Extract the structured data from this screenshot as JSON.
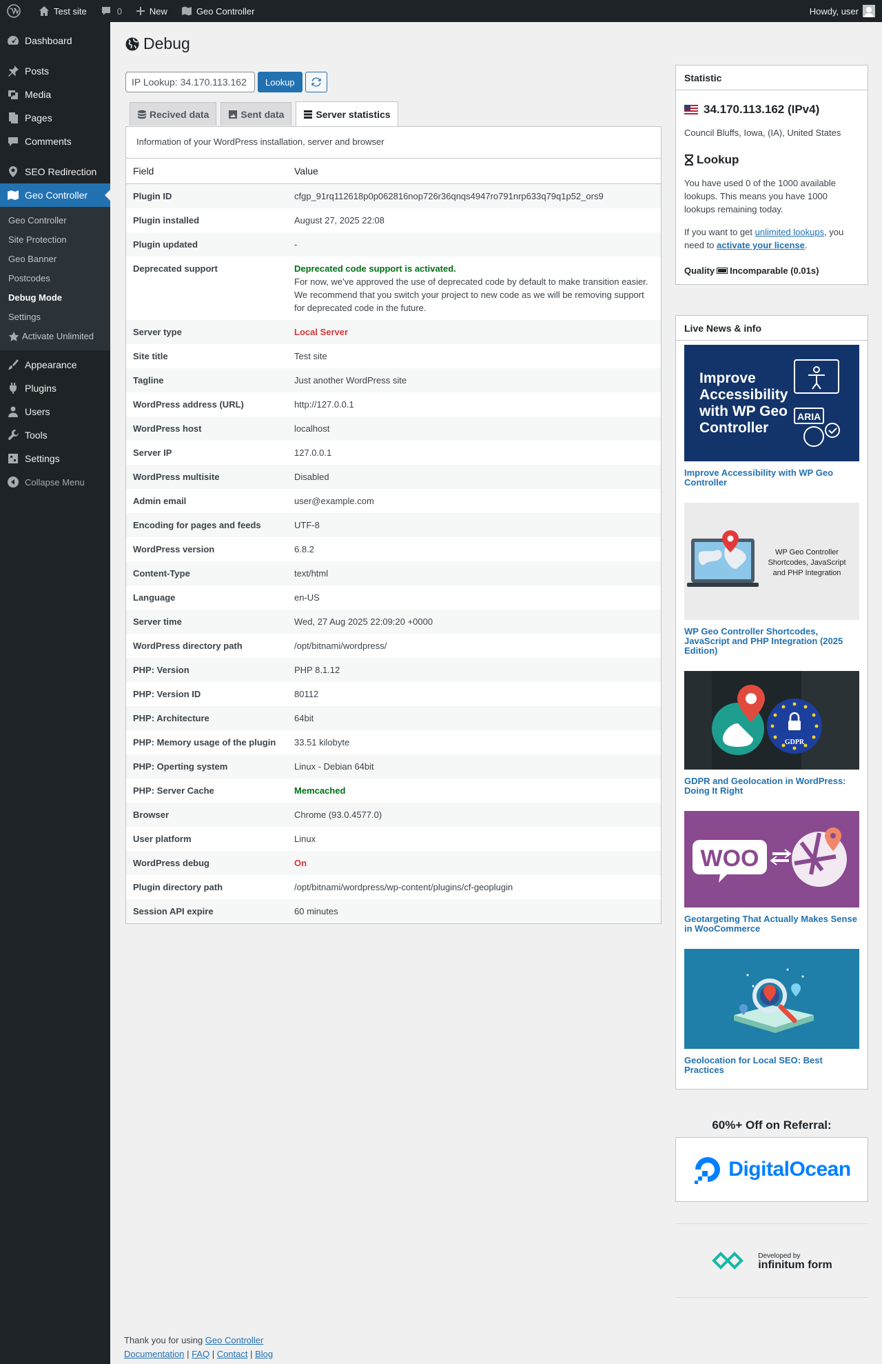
{
  "adminbar": {
    "site": "Test site",
    "comments_count": "0",
    "new_label": "New",
    "plugin_label": "Geo Controller",
    "howdy": "Howdy, user"
  },
  "sidebar": {
    "items": [
      {
        "label": "Dashboard",
        "icon": "dashboard-icon"
      },
      {
        "label": "Posts",
        "icon": "pin-icon"
      },
      {
        "label": "Media",
        "icon": "media-icon"
      },
      {
        "label": "Pages",
        "icon": "pages-icon"
      },
      {
        "label": "Comments",
        "icon": "comments-icon"
      },
      {
        "label": "SEO Redirection",
        "icon": "location-icon"
      },
      {
        "label": "Geo Controller",
        "icon": "map-icon"
      },
      {
        "label": "Appearance",
        "icon": "brush-icon"
      },
      {
        "label": "Plugins",
        "icon": "plugin-icon"
      },
      {
        "label": "Users",
        "icon": "users-icon"
      },
      {
        "label": "Tools",
        "icon": "wrench-icon"
      },
      {
        "label": "Settings",
        "icon": "settings-icon"
      }
    ],
    "submenu": [
      "Geo Controller",
      "Site Protection",
      "Geo Banner",
      "Postcodes",
      "Debug Mode",
      "Settings",
      "Activate Unlimited"
    ],
    "collapse": "Collapse Menu"
  },
  "page": {
    "title": "Debug",
    "lookup_value": "IP Lookup: 34.170.113.162",
    "lookup_button": "Lookup",
    "tabs": [
      "Recived data",
      "Sent data",
      "Server statistics"
    ],
    "description": "Information of your WordPress installation, server and browser",
    "col_field": "Field",
    "col_value": "Value"
  },
  "rows": [
    {
      "field": "Plugin ID",
      "value": "cfgp_91rq112618p0p062816nop726r36qnqs4947ro791nrp633q79q1p52_ors9"
    },
    {
      "field": "Plugin installed",
      "value": "August 27, 2025 22:08"
    },
    {
      "field": "Plugin updated",
      "value": "-"
    },
    {
      "field": "Deprecated support",
      "value": "Deprecated code support is activated.",
      "desc": "For now, we've approved the use of deprecated code by default to make transition easier. We recommend that you switch your project to new code as we will be removing support for deprecated code in the future."
    },
    {
      "field": "Server type",
      "value": "Local Server"
    },
    {
      "field": "Site title",
      "value": "Test site"
    },
    {
      "field": "Tagline",
      "value": "Just another WordPress site"
    },
    {
      "field": "WordPress address (URL)",
      "value": "http://127.0.0.1"
    },
    {
      "field": "WordPress host",
      "value": "localhost"
    },
    {
      "field": "Server IP",
      "value": "127.0.0.1"
    },
    {
      "field": "WordPress multisite",
      "value": "Disabled"
    },
    {
      "field": "Admin email",
      "value": "user@example.com"
    },
    {
      "field": "Encoding for pages and feeds",
      "value": "UTF-8"
    },
    {
      "field": "WordPress version",
      "value": "6.8.2"
    },
    {
      "field": "Content-Type",
      "value": "text/html"
    },
    {
      "field": "Language",
      "value": "en-US"
    },
    {
      "field": "Server time",
      "value": "Wed, 27 Aug 2025 22:09:20 +0000"
    },
    {
      "field": "WordPress directory path",
      "value": "/opt/bitnami/wordpress/"
    },
    {
      "field": "PHP: Version",
      "value": "PHP 8.1.12"
    },
    {
      "field": "PHP: Version ID",
      "value": "80112"
    },
    {
      "field": "PHP: Architecture",
      "value": "64bit"
    },
    {
      "field": "PHP: Memory usage of the plugin",
      "value": "33.51 kilobyte"
    },
    {
      "field": "PHP: Operting system",
      "value": "Linux - Debian 64bit"
    },
    {
      "field": "PHP: Server Cache",
      "value": "Memcached"
    },
    {
      "field": "Browser",
      "value": "Chrome (93.0.4577.0)"
    },
    {
      "field": "User platform",
      "value": "Linux"
    },
    {
      "field": "WordPress debug",
      "value": "On"
    },
    {
      "field": "Plugin directory path",
      "value": "/opt/bitnami/wordpress/wp-content/plugins/cf-geoplugin"
    },
    {
      "field": "Session API expire",
      "value": "60 minutes"
    }
  ],
  "statistic": {
    "heading": "Statistic",
    "ip": "34.170.113.162 (IPv4)",
    "location": "Council Bluffs, Iowa, (IA), United States",
    "lookup_heading": "Lookup",
    "lookup_text": "You have used 0 of the 1000 available lookups. This means you have 1000 lookups remaining today.",
    "unlimited_pre": "If you want to get ",
    "unlimited_link": "unlimited lookups",
    "unlimited_mid": ", you need to ",
    "activate_link": "activate your license",
    "unlimited_post": ".",
    "quality_label": "Quality",
    "quality_value": "Incomparable (0.01s)"
  },
  "news": {
    "heading": "Live News & info",
    "items": [
      {
        "title": "Improve Accessibility with WP Geo Controller",
        "img_text": [
          "Improve",
          "Accessibility",
          "with WP Geo",
          "Controller"
        ],
        "badge": "ARIA"
      },
      {
        "title": "WP Geo Controller Shortcodes, JavaScript and PHP Integration (2025 Edition)",
        "img_text": [
          "WP Geo Controller",
          "Shortcodes, JavaScript",
          "and PHP Integration"
        ]
      },
      {
        "title": "GDPR and Geolocation in WordPress: Doing It Right",
        "badge": "GDPR"
      },
      {
        "title": "Geotargeting That Actually Makes Sense in WooCommerce",
        "badge": "WOO"
      },
      {
        "title": "Geolocation for Local SEO: Best Practices"
      }
    ]
  },
  "referral": {
    "title": "60%+ Off on Referral:",
    "brand": "DigitalOcean",
    "dev_small": "Developed by",
    "dev_big": "infinitum form"
  },
  "footer": {
    "thanks": "Thank you for using ",
    "plugin_link": "Geo Controller",
    "links": [
      "Documentation",
      "FAQ",
      "Contact",
      "Blog"
    ]
  },
  "colors": {
    "accent": "#2271b1",
    "sidebar_bg": "#1d2327",
    "success": "#007017",
    "danger": "#d63638"
  }
}
